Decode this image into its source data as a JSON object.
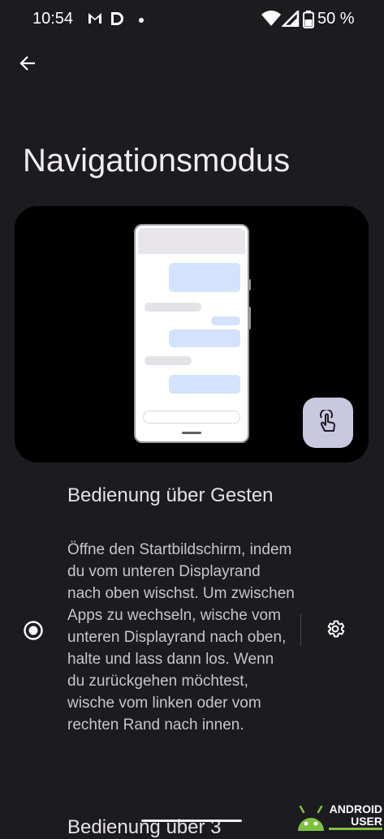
{
  "status_bar": {
    "time": "10:54",
    "icons": [
      "gmail-icon",
      "app-d-icon",
      "dot-icon",
      "wifi-icon",
      "signal-icon",
      "battery-icon"
    ],
    "battery_percent": "50 %"
  },
  "header": {
    "back_icon": "arrow-back-icon"
  },
  "page": {
    "title": "Navigationsmodus"
  },
  "illustration": {
    "gesture_icon": "touch-gesture-icon"
  },
  "options": [
    {
      "title": "Bedienung über Gesten",
      "description": "Öffne den Startbildschirm, indem du vom unteren Displayrand nach oben wischst. Um zwischen Apps zu wechseln, wische vom unteren Displayrand nach oben, halte und lass dann los. Wenn du zurück­gehen möchtest, wische vom linken oder vom rechten Rand nach innen.",
      "selected": true,
      "settings_icon": "gear-icon"
    },
    {
      "title": "Bedienung über 3"
    }
  ],
  "watermark": {
    "line1": "ANDROID",
    "line2": "USER"
  },
  "colors": {
    "background": "#1c1b20",
    "accent_button": "#c9c8e0",
    "bubble_blue": "#d3e3fd"
  }
}
